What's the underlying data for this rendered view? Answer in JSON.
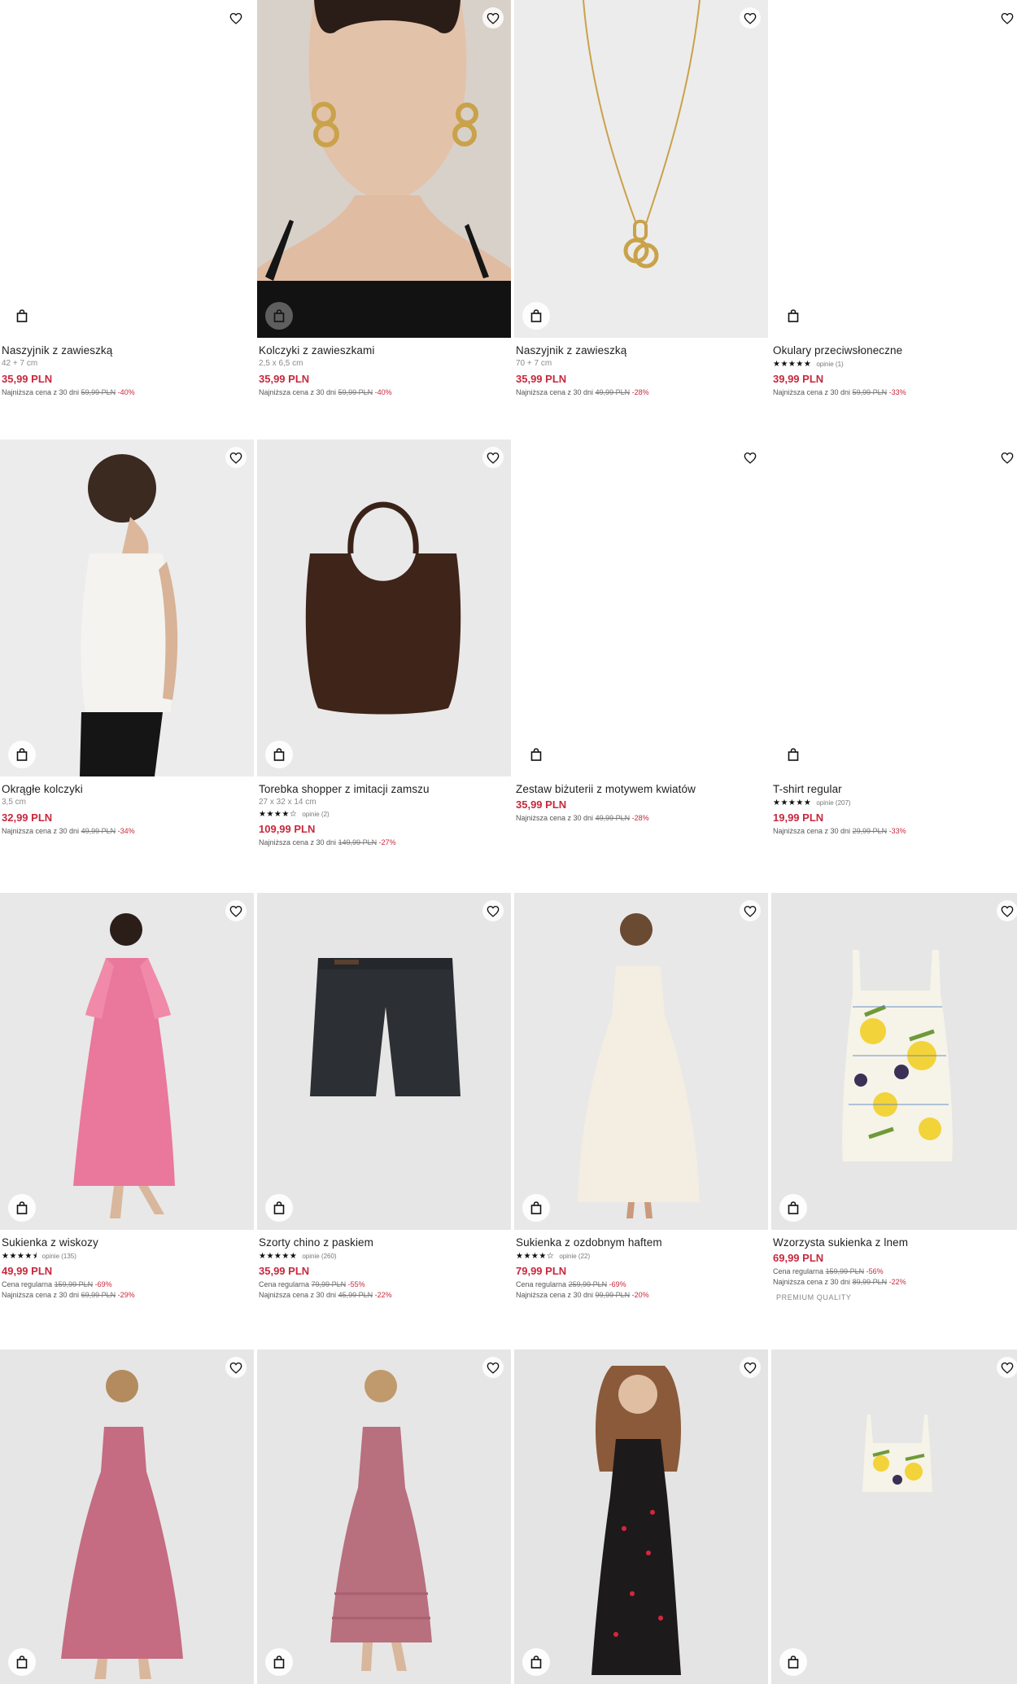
{
  "colors": {
    "sale": "#c8283d",
    "text": "#1f1f1f",
    "muted": "#8a8a8a"
  },
  "icons": {
    "favorite": "heart-outline-icon",
    "add_to_bag": "shopping-bag-icon"
  },
  "products": [
    {
      "name": "Naszyjnik z zawieszką",
      "size": "42 + 7 cm",
      "price": "35,99 PLN",
      "lowest_label": "Najniższa cena z 30 dni",
      "lowest_old": "59,99 PLN",
      "lowest_disc": "-40%"
    },
    {
      "name": "Kolczyki z zawieszkami",
      "size": "2,5 x 6,5 cm",
      "price": "35,99 PLN",
      "lowest_label": "Najniższa cena z 30 dni",
      "lowest_old": "59,99 PLN",
      "lowest_disc": "-40%"
    },
    {
      "name": "Naszyjnik z zawieszką",
      "size": "70 + 7 cm",
      "price": "35,99 PLN",
      "lowest_label": "Najniższa cena z 30 dni",
      "lowest_old": "49,99 PLN",
      "lowest_disc": "-28%"
    },
    {
      "name": "Okulary przeciwsłoneczne",
      "stars": "★★★★★",
      "reviews": "opinie (1)",
      "price": "39,99 PLN",
      "lowest_label": "Najniższa cena z 30 dni",
      "lowest_old": "59,99 PLN",
      "lowest_disc": "-33%"
    },
    {
      "name": "Okrągłe kolczyki",
      "size": "3,5 cm",
      "price": "32,99 PLN",
      "lowest_label": "Najniższa cena z 30 dni",
      "lowest_old": "49,99 PLN",
      "lowest_disc": "-34%"
    },
    {
      "name": "Torebka shopper z imitacji zamszu",
      "size": "27 x 32 x 14 cm",
      "stars": "★★★★☆",
      "reviews": "opinie (2)",
      "price": "109,99 PLN",
      "lowest_label": "Najniższa cena z 30 dni",
      "lowest_old": "149,99 PLN",
      "lowest_disc": "-27%"
    },
    {
      "name": "Zestaw biżuterii z motywem kwiatów",
      "price": "35,99 PLN",
      "lowest_label": "Najniższa cena z 30 dni",
      "lowest_old": "49,99 PLN",
      "lowest_disc": "-28%"
    },
    {
      "name": "T-shirt regular",
      "stars": "★★★★★",
      "reviews": "opinie (207)",
      "price": "19,99 PLN",
      "lowest_label": "Najniższa cena z 30 dni",
      "lowest_old": "29,99 PLN",
      "lowest_disc": "-33%"
    },
    {
      "name": "Sukienka z wiskozy",
      "stars": "★★★★⯨",
      "reviews": "opinie (135)",
      "price": "49,99 PLN",
      "regular_label": "Cena regularna",
      "regular_old": "159,99 PLN",
      "regular_disc": "-69%",
      "lowest_label": "Najniższa cena z 30 dni",
      "lowest_old": "69,99 PLN",
      "lowest_disc": "-29%"
    },
    {
      "name": "Szorty chino z paskiem",
      "stars": "★★★★★",
      "reviews": "opinie (260)",
      "price": "35,99 PLN",
      "regular_label": "Cena regularna",
      "regular_old": "79,99 PLN",
      "regular_disc": "-55%",
      "lowest_label": "Najniższa cena z 30 dni",
      "lowest_old": "45,99 PLN",
      "lowest_disc": "-22%"
    },
    {
      "name": "Sukienka z ozdobnym haftem",
      "stars": "★★★★☆",
      "reviews": "opinie (22)",
      "price": "79,99 PLN",
      "regular_label": "Cena regularna",
      "regular_old": "259,99 PLN",
      "regular_disc": "-69%",
      "lowest_label": "Najniższa cena z 30 dni",
      "lowest_old": "99,99 PLN",
      "lowest_disc": "-20%"
    },
    {
      "name": "Wzorzysta sukienka z lnem",
      "price": "69,99 PLN",
      "regular_label": "Cena regularna",
      "regular_old": "159,99 PLN",
      "regular_disc": "-56%",
      "lowest_label": "Najniższa cena z 30 dni",
      "lowest_old": "89,99 PLN",
      "lowest_disc": "-22%",
      "badge": "PREMIUM QUALITY"
    },
    {
      "name": ""
    },
    {
      "name": ""
    },
    {
      "name": ""
    },
    {
      "name": ""
    }
  ]
}
